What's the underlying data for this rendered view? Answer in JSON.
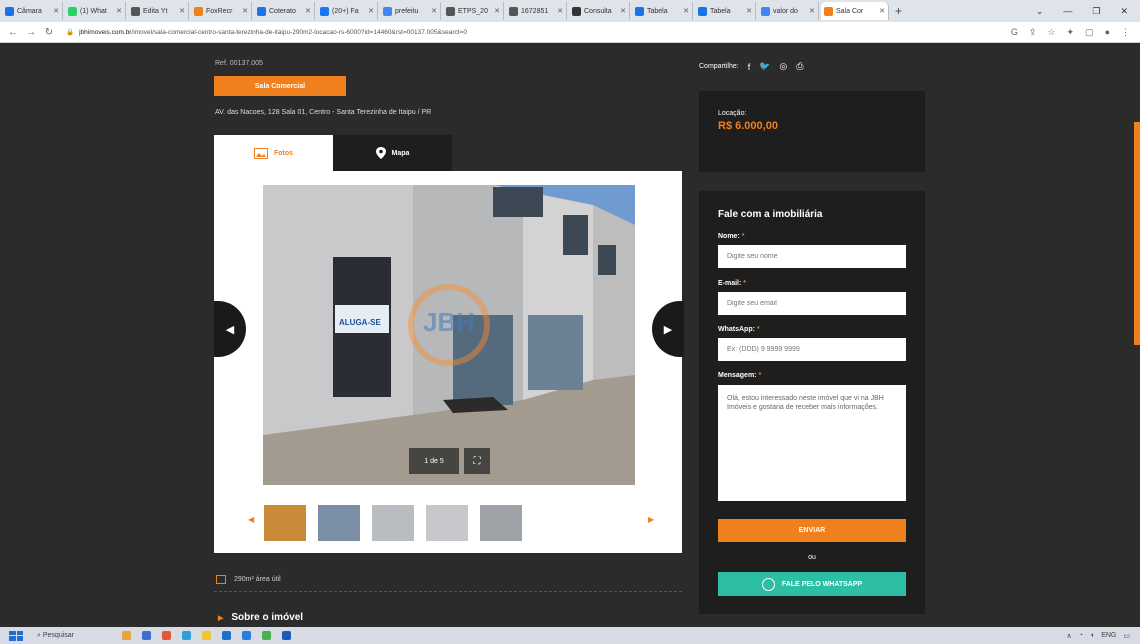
{
  "browser": {
    "tabs": [
      {
        "label": "Câmara",
        "color": "#1a73e8"
      },
      {
        "label": "(1) What",
        "color": "#25d366"
      },
      {
        "label": "Edita Yt",
        "color": "#555555"
      },
      {
        "label": "FoxRecr",
        "color": "#f07f1d"
      },
      {
        "label": "Coterato",
        "color": "#1a73e8"
      },
      {
        "label": "(20+) Fa",
        "color": "#1877f2"
      },
      {
        "label": "prefeitu",
        "color": "#4285f4"
      },
      {
        "label": "ETPS_20",
        "color": "#555555"
      },
      {
        "label": "1672851",
        "color": "#555555"
      },
      {
        "label": "Consulta",
        "color": "#333333"
      },
      {
        "label": "Tabela",
        "color": "#1a73e8"
      },
      {
        "label": "Tabela",
        "color": "#1a73e8"
      },
      {
        "label": "valor do",
        "color": "#4285f4"
      },
      {
        "label": "Sala Cor",
        "color": "#f07f1d"
      }
    ],
    "new_tab": "+",
    "url_domain": "jbhimoveis.com.br",
    "url_path": "/imovel/sala-comercial-centro-santa-terezinha-de-itaipu-290m2-locacao-rs-6000?id=14460&rst=00137.005&searct=0"
  },
  "listing": {
    "ref": "Ref. 00137.005",
    "type": "Sala Comercial",
    "address": "AV. das Nacoes, 128 Sala 01, Centro - Santa Terezinha de Itaipu / PR",
    "tab_photos": "Fotos",
    "tab_map": "Mapa",
    "counter": "1 de 5",
    "sign_text": "ALUGA-SE",
    "watermark": "JBH",
    "area": "290m² área útil",
    "about": "Sobre o imóvel"
  },
  "sidebar": {
    "share_label": "Compartilhe:",
    "price_label": "Locação:",
    "price_value": "R$ 6.000,00",
    "contact_title": "Fale com a imobiliária",
    "name_label": "Nome:",
    "name_placeholder": "Digite seu nome",
    "email_label": "E-mail:",
    "email_placeholder": "Digite seu email",
    "whatsapp_label": "WhatsApp:",
    "whatsapp_placeholder": "Ex: (DDD) 9 9999 9999",
    "message_label": "Mensagem:",
    "message_value": "Olá, estou interessado neste imóvel que vi na JBH Imóveis e gostaria de receber mais informações.",
    "required_mark": "*",
    "send_label": "ENVIAR",
    "or_label": "ou",
    "whatsapp_button": "FALE PELO WHATSAPP"
  },
  "taskbar": {
    "search": "Pesquisar",
    "tray": "ENG",
    "accent": "#1f6fd1"
  },
  "colors": {
    "accent": "#f07f1d",
    "whatsapp": "#2dbfa4",
    "panel": "#1e1e1e",
    "page_bg": "#2b2b2b"
  }
}
